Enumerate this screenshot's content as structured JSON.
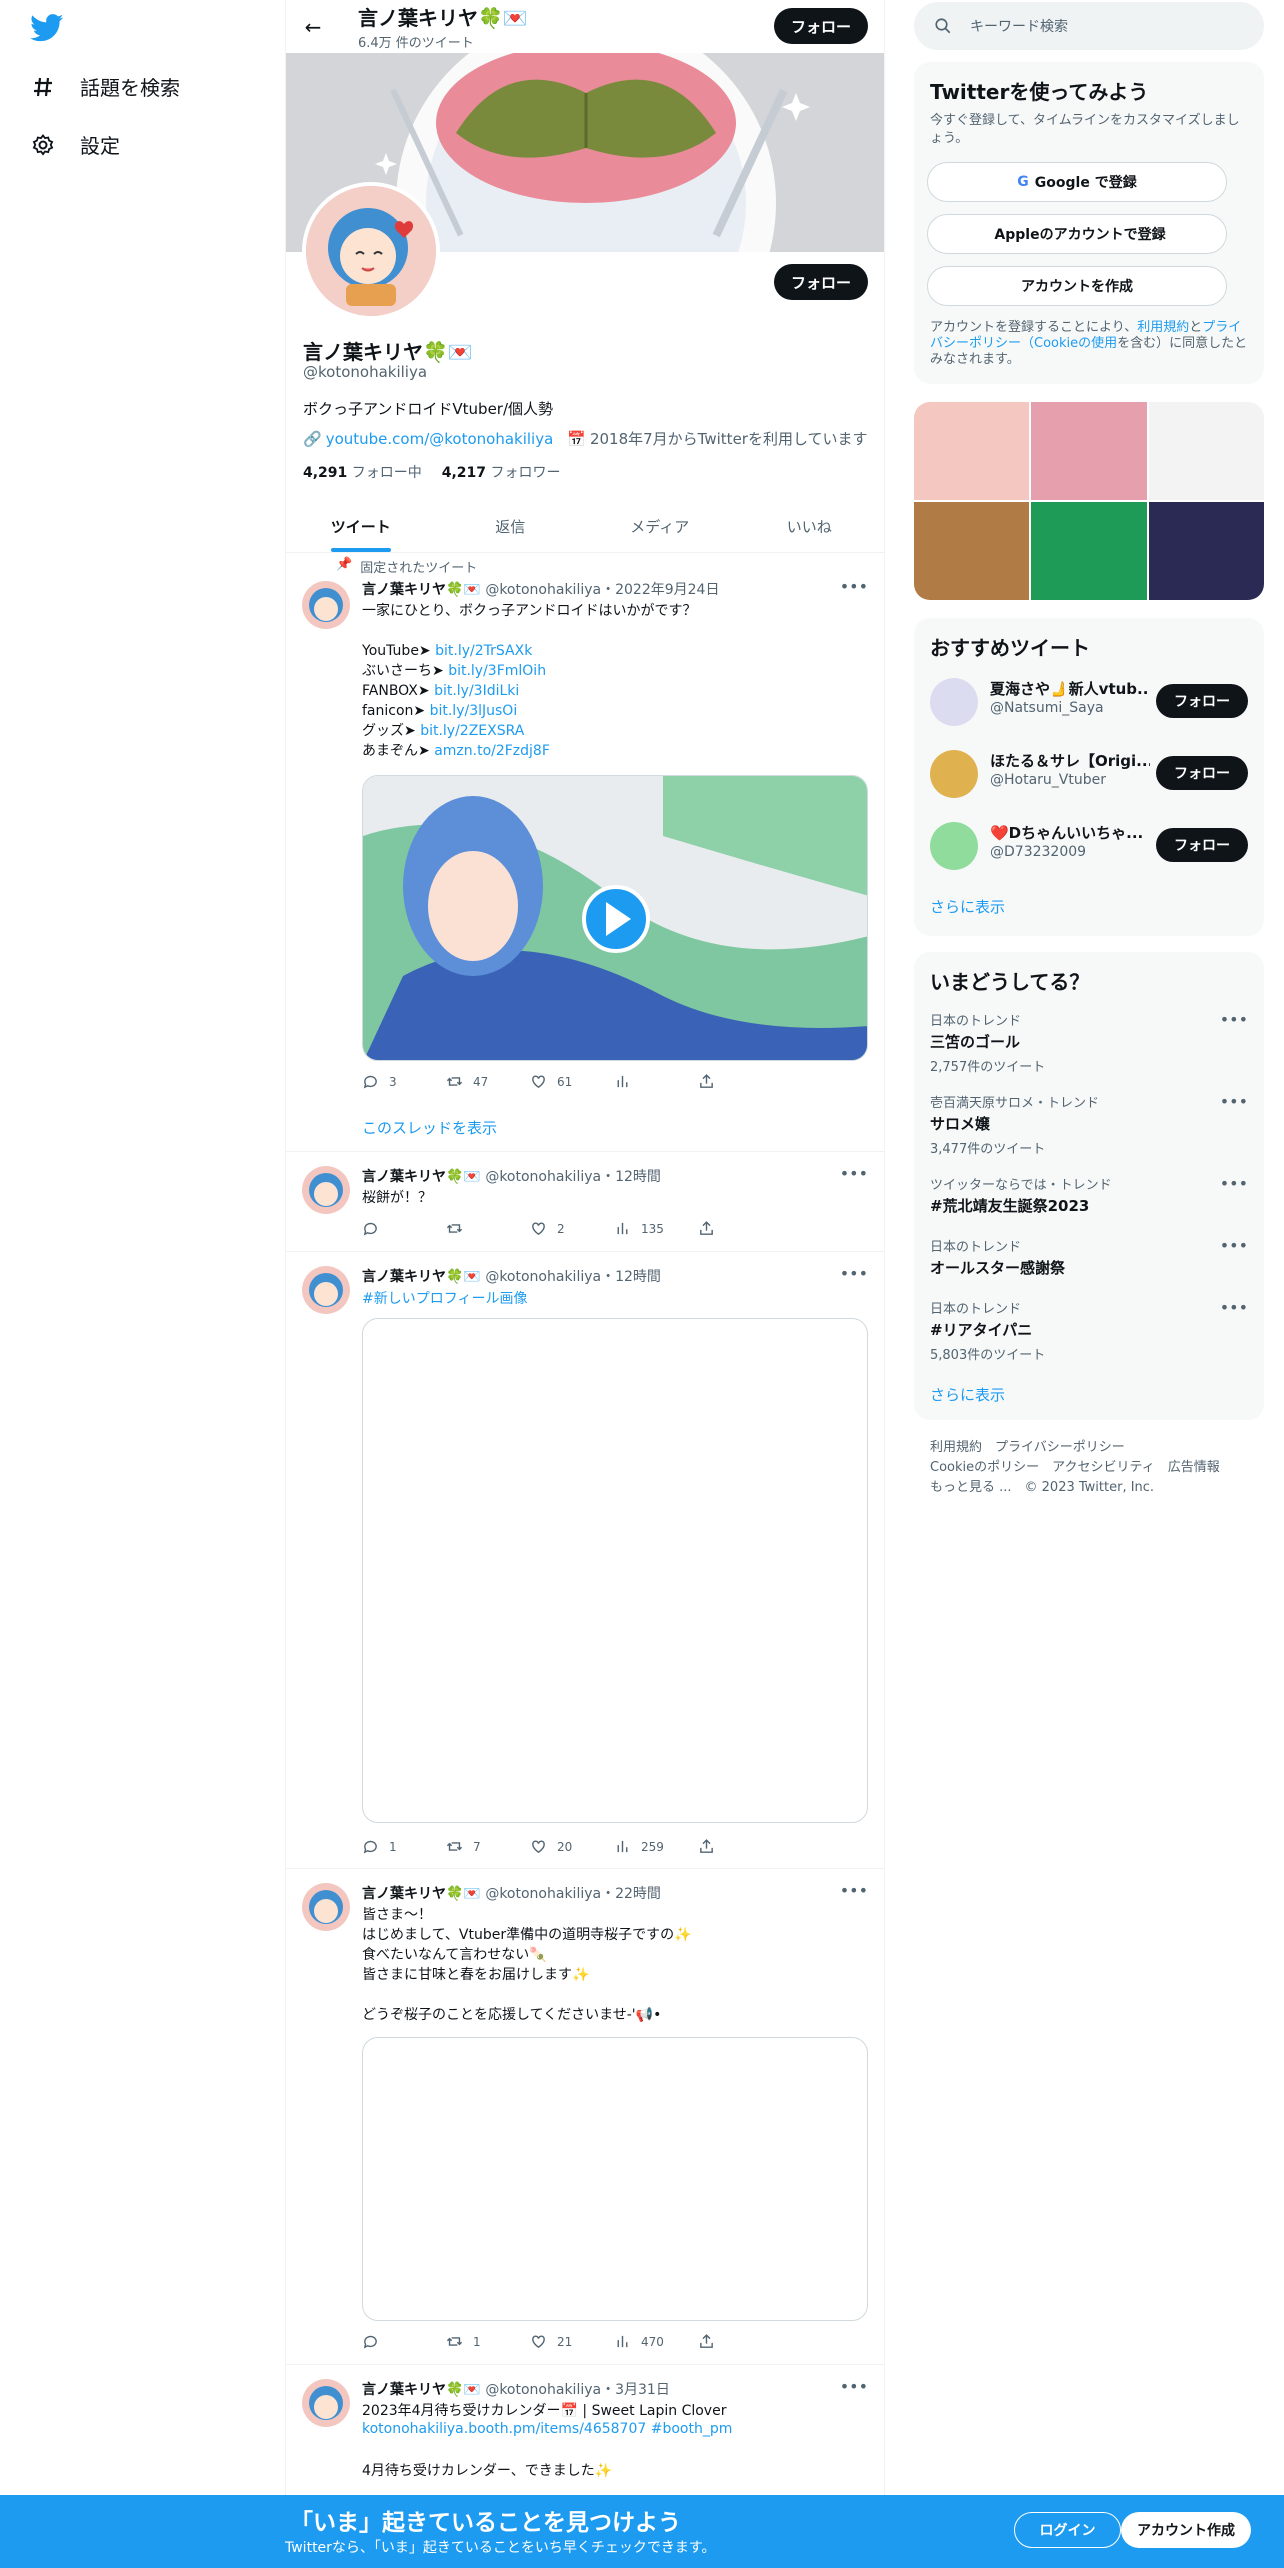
{
  "nav": {
    "explore_label": "話題を検索",
    "settings_label": "設定"
  },
  "header": {
    "name": "言ノ葉キリヤ🍀💌",
    "tweet_count": "6.4万 件のツイート",
    "follow_label": "フォロー"
  },
  "profile": {
    "name": "言ノ葉キリヤ🍀💌",
    "handle": "@kotonohakiliya",
    "bio": "ボクっ子アンドロイドVtuber/個人勢",
    "link": "youtube.com/@kotonohakiliya",
    "joined": "2018年7月からTwitterを利用しています",
    "following_count": "4,291",
    "following_label": "フォロー中",
    "followers_count": "4,217",
    "followers_label": "フォロワー",
    "follow_label": "フォロー"
  },
  "tabs": [
    {
      "label": "ツイート"
    },
    {
      "label": "返信"
    },
    {
      "label": "メディア"
    },
    {
      "label": "いいね"
    }
  ],
  "pinned_label": "固定されたツイート",
  "tweets": [
    {
      "name": "言ノ葉キリヤ🍀💌",
      "handle": "@kotonohakiliya",
      "time": "・2022年9月24日",
      "text": "一家にひとり、ボクっ子アンドロイドはいかがです？",
      "lines": [
        {
          "prefix": "YouTube➤ ",
          "link": "bit.ly/2TrSAXk"
        },
        {
          "prefix": "ぶいさーち➤ ",
          "link": "bit.ly/3FmlOih"
        },
        {
          "prefix": "FANBOX➤ ",
          "link": "bit.ly/3IdiLki"
        },
        {
          "prefix": "fanicon➤ ",
          "link": "bit.ly/3lJusOi"
        },
        {
          "prefix": "グッズ➤ ",
          "link": "bit.ly/2ZEXSRA"
        },
        {
          "prefix": "あまぞん➤ ",
          "link": "amzn.to/2Fzdj8F"
        }
      ],
      "replies": "3",
      "retweets": "47",
      "likes": "61",
      "thread_label": "このスレッドを表示"
    },
    {
      "name": "言ノ葉キリヤ🍀💌",
      "handle": "@kotonohakiliya",
      "time": "・12時間",
      "text": "桜餅が！？",
      "replies": "",
      "retweets": "",
      "likes": "2",
      "views": "135"
    },
    {
      "name": "言ノ葉キリヤ🍀💌",
      "handle": "@kotonohakiliya",
      "time": "・12時間",
      "hashtag": "#新しいプロフィール画像",
      "replies": "1",
      "retweets": "7",
      "likes": "20",
      "views": "259"
    },
    {
      "name": "言ノ葉キリヤ🍀💌",
      "handle": "@kotonohakiliya",
      "time": "・22時間",
      "text": "皆さま～！\nはじめまして、Vtuber準備中の道明寺桜子ですの✨\n食べたいなんて言わせない🍡\n皆さまに甘味と春をお届けします✨\n\nどうぞ桜子のことを応援してくださいませ-'📢•",
      "replies": "",
      "retweets": "1",
      "likes": "21",
      "views": "470"
    },
    {
      "name": "言ノ葉キリヤ🍀💌",
      "handle": "@kotonohakiliya",
      "time": "・3月31日",
      "text": "2023年4月待ち受けカレンダー📅 | Sweet Lapin Clover",
      "link": "kotonohakiliya.booth.pm/items/4658707 #booth_pm",
      "text2": "4月待ち受けカレンダー、できました✨"
    }
  ],
  "sidebar": {
    "search_placeholder": "キーワード検索",
    "signup_title": "Twitterを使ってみよう",
    "signup_sub": "今すぐ登録して、タイムラインをカスタマイズしましょう。",
    "google_label": "Google で登録",
    "apple_label": "Appleのアカウントで登録",
    "create_label": "アカウントを作成",
    "terms_prefix": "アカウントを登録することにより、",
    "terms_link1": "利用規約",
    "terms_mid": "と",
    "terms_link2": "プライバシーポリシー（Cookieの使用",
    "terms_suffix": "を含む）に同意したとみなされます。",
    "recommend_title": "おすすめツイート",
    "suggestions": [
      {
        "name": "夏海さや🫸新人vtub...",
        "handle": "@Natsumi_Saya",
        "follow": "フォロー"
      },
      {
        "name": "ほたる＆サレ【Origi...",
        "handle": "@Hotaru_Vtuber",
        "follow": "フォロー"
      },
      {
        "name": "❤️Dちゃんいいちゃ...",
        "handle": "@D73232009",
        "follow": "フォロー"
      }
    ],
    "show_more": "さらに表示",
    "trends_title": "いまどうしてる？",
    "trends": [
      {
        "context": "日本のトレンド",
        "title": "三笘のゴール",
        "count": "2,757件のツイート"
      },
      {
        "context": "壱百満天原サロメ・トレンド",
        "title": "サロメ嬢",
        "count": "3,477件のツイート"
      },
      {
        "context": "ツイッターならでは・トレンド",
        "title": "#荒北靖友生誕祭2023",
        "count": ""
      },
      {
        "context": "日本のトレンド",
        "title": "オールスター感謝祭",
        "count": ""
      },
      {
        "context": "日本のトレンド",
        "title": "#リアタイパニ",
        "count": "5,803件のツイート"
      }
    ],
    "trends_more": "さらに表示",
    "footer_line1": "利用規約　プライバシーポリシー",
    "footer_line2": "Cookieのポリシー　アクセシビリティ　広告情報",
    "footer_line3": "もっと見る ...　© 2023 Twitter, Inc."
  },
  "bottom": {
    "title": "「いま」起きていることを見つけよう",
    "subtitle": "Twitterなら、「いま」起きていることをいち早くチェックできます。",
    "login": "ログイン",
    "signup": "アカウント作成"
  },
  "colors": {
    "accent": "#1d9bf0",
    "text": "#0f1419",
    "muted": "#536471"
  }
}
